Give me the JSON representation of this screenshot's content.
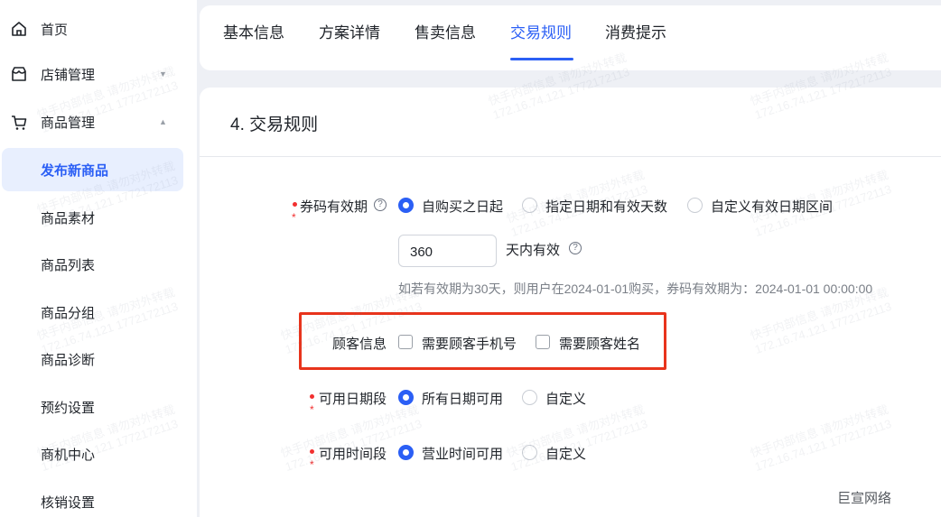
{
  "sidebar": {
    "home": "首页",
    "shop": "店铺管理",
    "goods": "商品管理",
    "sub_items": [
      "发布新商品",
      "商品素材",
      "商品列表",
      "商品分组",
      "商品诊断",
      "预约设置",
      "商机中心",
      "核销设置"
    ],
    "active_index": 0
  },
  "tabs": [
    "基本信息",
    "方案详情",
    "售卖信息",
    "交易规则",
    "消费提示"
  ],
  "active_tab": "交易规则",
  "section_title": "4. 交易规则",
  "validity": {
    "label": "券码有效期",
    "options": [
      "自购买之日起",
      "指定日期和有效天数",
      "自定义有效日期区间"
    ],
    "selected": "自购买之日起",
    "days_value": "360",
    "days_suffix": "天内有效",
    "hint": "如若有效期为30天，则用户在2024-01-01购买，券码有效期为：2024-01-01 00:00:00"
  },
  "customer_info": {
    "label": "顾客信息",
    "options": [
      "需要顾客手机号",
      "需要顾客姓名"
    ]
  },
  "date_range": {
    "label": "可用日期段",
    "options": [
      "所有日期可用",
      "自定义"
    ],
    "selected": "所有日期可用"
  },
  "time_range": {
    "label": "可用时间段",
    "options": [
      "营业时间可用",
      "自定义"
    ],
    "selected": "营业时间可用"
  },
  "required_mark": "*",
  "help_glyph": "?",
  "chevron_down": "▼",
  "chevron_up": "▲",
  "watermark_brand": "巨宣网络",
  "watermark_lines": [
    "快手内部信息 请勿对外转载",
    "172.16.74.121 1772172113"
  ],
  "colors": {
    "accent": "#2b5ff5",
    "required": "#f23030",
    "highlight_box": "#e8341c"
  }
}
